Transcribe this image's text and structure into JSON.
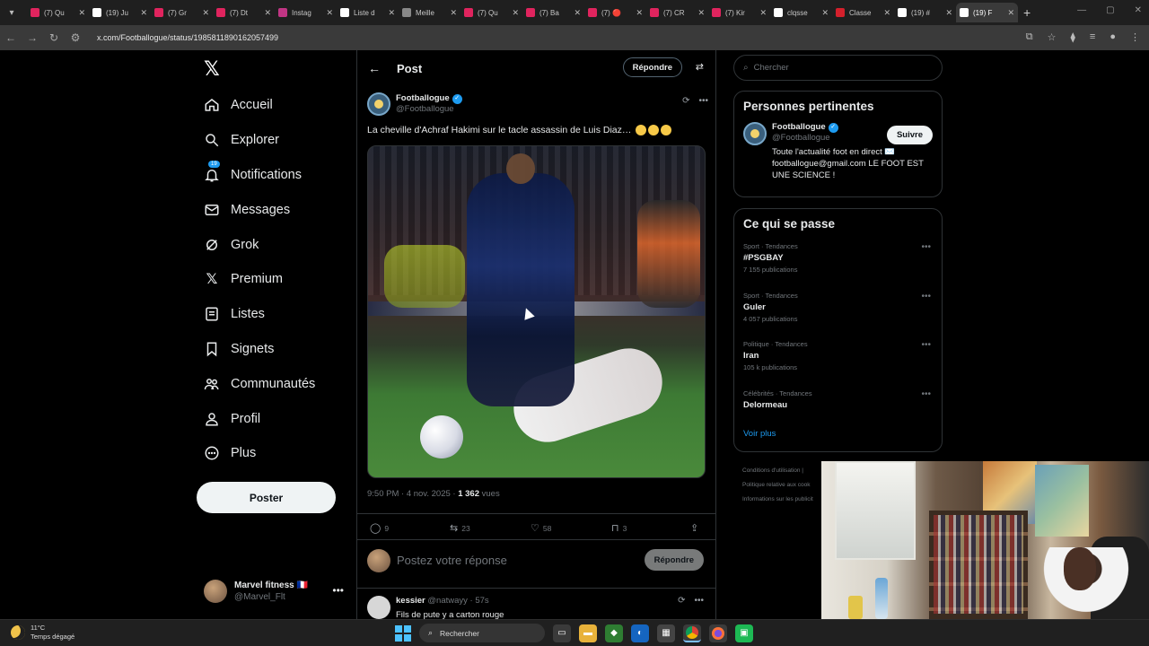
{
  "browser": {
    "tabs": [
      {
        "title": "(7) Qu",
        "color": "#e0245e"
      },
      {
        "title": "(19) Ju",
        "color": "#ffffff"
      },
      {
        "title": "(7) Gr",
        "color": "#e0245e"
      },
      {
        "title": "(7) Dt",
        "color": "#e0245e"
      },
      {
        "title": "Instag",
        "color": "#c13584"
      },
      {
        "title": "Liste d",
        "color": "#ffffff"
      },
      {
        "title": "Meille",
        "color": "#888888"
      },
      {
        "title": "(7) Qu",
        "color": "#e0245e"
      },
      {
        "title": "(7) Ba",
        "color": "#e0245e"
      },
      {
        "title": "(7) 🔴",
        "color": "#e0245e"
      },
      {
        "title": "(7) CR",
        "color": "#e0245e"
      },
      {
        "title": "(7) Kir",
        "color": "#e0245e"
      },
      {
        "title": "clqsse",
        "color": "#ffffff"
      },
      {
        "title": "Classe",
        "color": "#d4202c"
      },
      {
        "title": "(19) #",
        "color": "#ffffff"
      },
      {
        "title": "(19) F",
        "color": "#ffffff",
        "active": true
      }
    ],
    "url": "x.com/Footballogue/status/1985811890162057499"
  },
  "sidebar": {
    "items": [
      {
        "label": "Accueil",
        "icon": "home-icon"
      },
      {
        "label": "Explorer",
        "icon": "search-icon"
      },
      {
        "label": "Notifications",
        "icon": "bell-icon",
        "badge": "19"
      },
      {
        "label": "Messages",
        "icon": "mail-icon"
      },
      {
        "label": "Grok",
        "icon": "grok-icon"
      },
      {
        "label": "Premium",
        "icon": "x-icon"
      },
      {
        "label": "Listes",
        "icon": "list-icon"
      },
      {
        "label": "Signets",
        "icon": "bookmark-icon"
      },
      {
        "label": "Communautés",
        "icon": "community-icon"
      },
      {
        "label": "Profil",
        "icon": "person-icon"
      },
      {
        "label": "Plus",
        "icon": "more-circle-icon"
      }
    ],
    "post_label": "Poster",
    "profile": {
      "name": "Marvel fitness 🇫🇷",
      "handle": "@Marvel_Flt"
    }
  },
  "header": {
    "title": "Post",
    "reply_label": "Répondre"
  },
  "tweet": {
    "author_name": "Footballogue",
    "author_handle": "@Footballogue",
    "text": "La cheville d'Achraf Hakimi sur le tacle assassin de Luis Diaz…",
    "time": "9:50 PM · 4 nov. 2025 · ",
    "views_count": "1 362",
    "views_label": " vues",
    "stats": {
      "replies": "9",
      "retweets": "23",
      "likes": "58",
      "bookmarks": "3"
    }
  },
  "reply_box": {
    "placeholder": "Postez votre réponse",
    "button": "Répondre"
  },
  "comment": {
    "name": "kessier",
    "handle": "@natwayy · 57s",
    "text": "Fils de pute y a carton rouge"
  },
  "right": {
    "search_placeholder": "Chercher",
    "relevant": {
      "title": "Personnes pertinentes",
      "name": "Footballogue",
      "handle": "@Footballogue",
      "follow": "Suivre",
      "bio": "Toute l'actualité foot en direct ✉️ footballogue@gmail.com LE FOOT EST UNE SCIENCE !"
    },
    "trends": {
      "title": "Ce qui se passe",
      "items": [
        {
          "cat": "Sport · Tendances",
          "name": "#PSGBAY",
          "count": "7 155 publications"
        },
        {
          "cat": "Sport · Tendances",
          "name": "Guler",
          "count": "4 057 publications"
        },
        {
          "cat": "Politique · Tendances",
          "name": "Iran",
          "count": "105 k publications"
        },
        {
          "cat": "Célébrités · Tendances",
          "name": "Delormeau",
          "count": ""
        }
      ],
      "see_more": "Voir plus"
    },
    "footer": [
      "Conditions d'utilisation |",
      "Politique relative aux cook",
      "Informations sur les publicit"
    ]
  },
  "taskbar": {
    "temp": "11°C",
    "weather": "Temps dégagé",
    "search": "Rechercher"
  }
}
